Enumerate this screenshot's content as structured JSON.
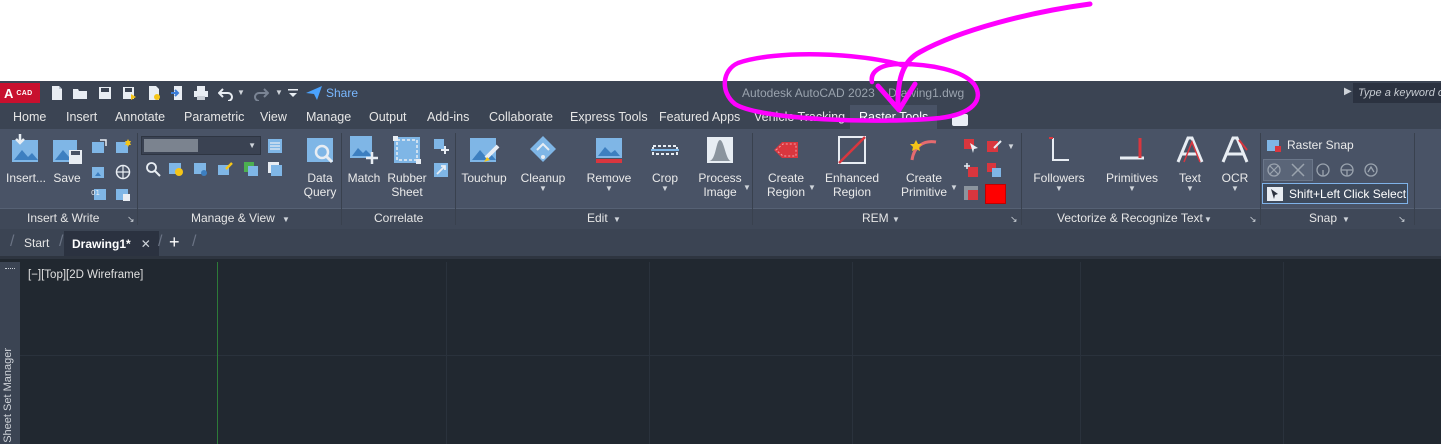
{
  "title_bar": {
    "logo_text": "A",
    "logo_sub": "CAD",
    "share_label": "Share",
    "window_title": "Autodesk AutoCAD 2023    Drawing1.dwg",
    "search_placeholder": "Type a keyword or phrase"
  },
  "ribbon_tabs": [
    {
      "label": "Home"
    },
    {
      "label": "Insert"
    },
    {
      "label": "Annotate"
    },
    {
      "label": "Parametric"
    },
    {
      "label": "View"
    },
    {
      "label": "Manage"
    },
    {
      "label": "Output"
    },
    {
      "label": "Add-ins"
    },
    {
      "label": "Collaborate"
    },
    {
      "label": "Express Tools"
    },
    {
      "label": "Featured Apps"
    },
    {
      "label": "Vehicle Tracking"
    },
    {
      "label": "Raster Tools"
    }
  ],
  "ribbon": {
    "insert_write": {
      "title": "Insert & Write",
      "insert": "Insert...",
      "save": "Save"
    },
    "manage_view": {
      "title": "Manage & View"
    },
    "correlate": {
      "title": "Correlate",
      "data_query_1": "Data",
      "data_query_2": "Query",
      "match": "Match",
      "rubber_1": "Rubber",
      "rubber_2": "Sheet"
    },
    "edit": {
      "title": "Edit",
      "touchup": "Touchup",
      "cleanup": "Cleanup",
      "remove": "Remove",
      "crop": "Crop",
      "process_1": "Process",
      "process_2": "Image"
    },
    "rem": {
      "title": "REM",
      "create_region_1": "Create",
      "create_region_2": "Region",
      "enhanced_1": "Enhanced",
      "enhanced_2": "Region",
      "create_prim_1": "Create",
      "create_prim_2": "Primitive"
    },
    "vectorize": {
      "title": "Vectorize & Recognize Text",
      "followers": "Followers",
      "primitives": "Primitives",
      "text": "Text",
      "ocr": "OCR"
    },
    "snap": {
      "title": "Snap",
      "raster_snap": "Raster Snap",
      "shift_click": "Shift+Left Click Select"
    }
  },
  "file_tabs": {
    "start": "Start",
    "drawing": "Drawing1*",
    "close": "✕",
    "add": "+"
  },
  "canvas": {
    "view_label": "[−][Top][2D Wireframe]",
    "side_panel": "Sheet Set Manager"
  },
  "colors": {
    "title_bar": "#3b4453",
    "ribbon": "#495366",
    "canvas": "#212830",
    "annotation": "#ff00ff",
    "accent_red": "#ff0000"
  }
}
